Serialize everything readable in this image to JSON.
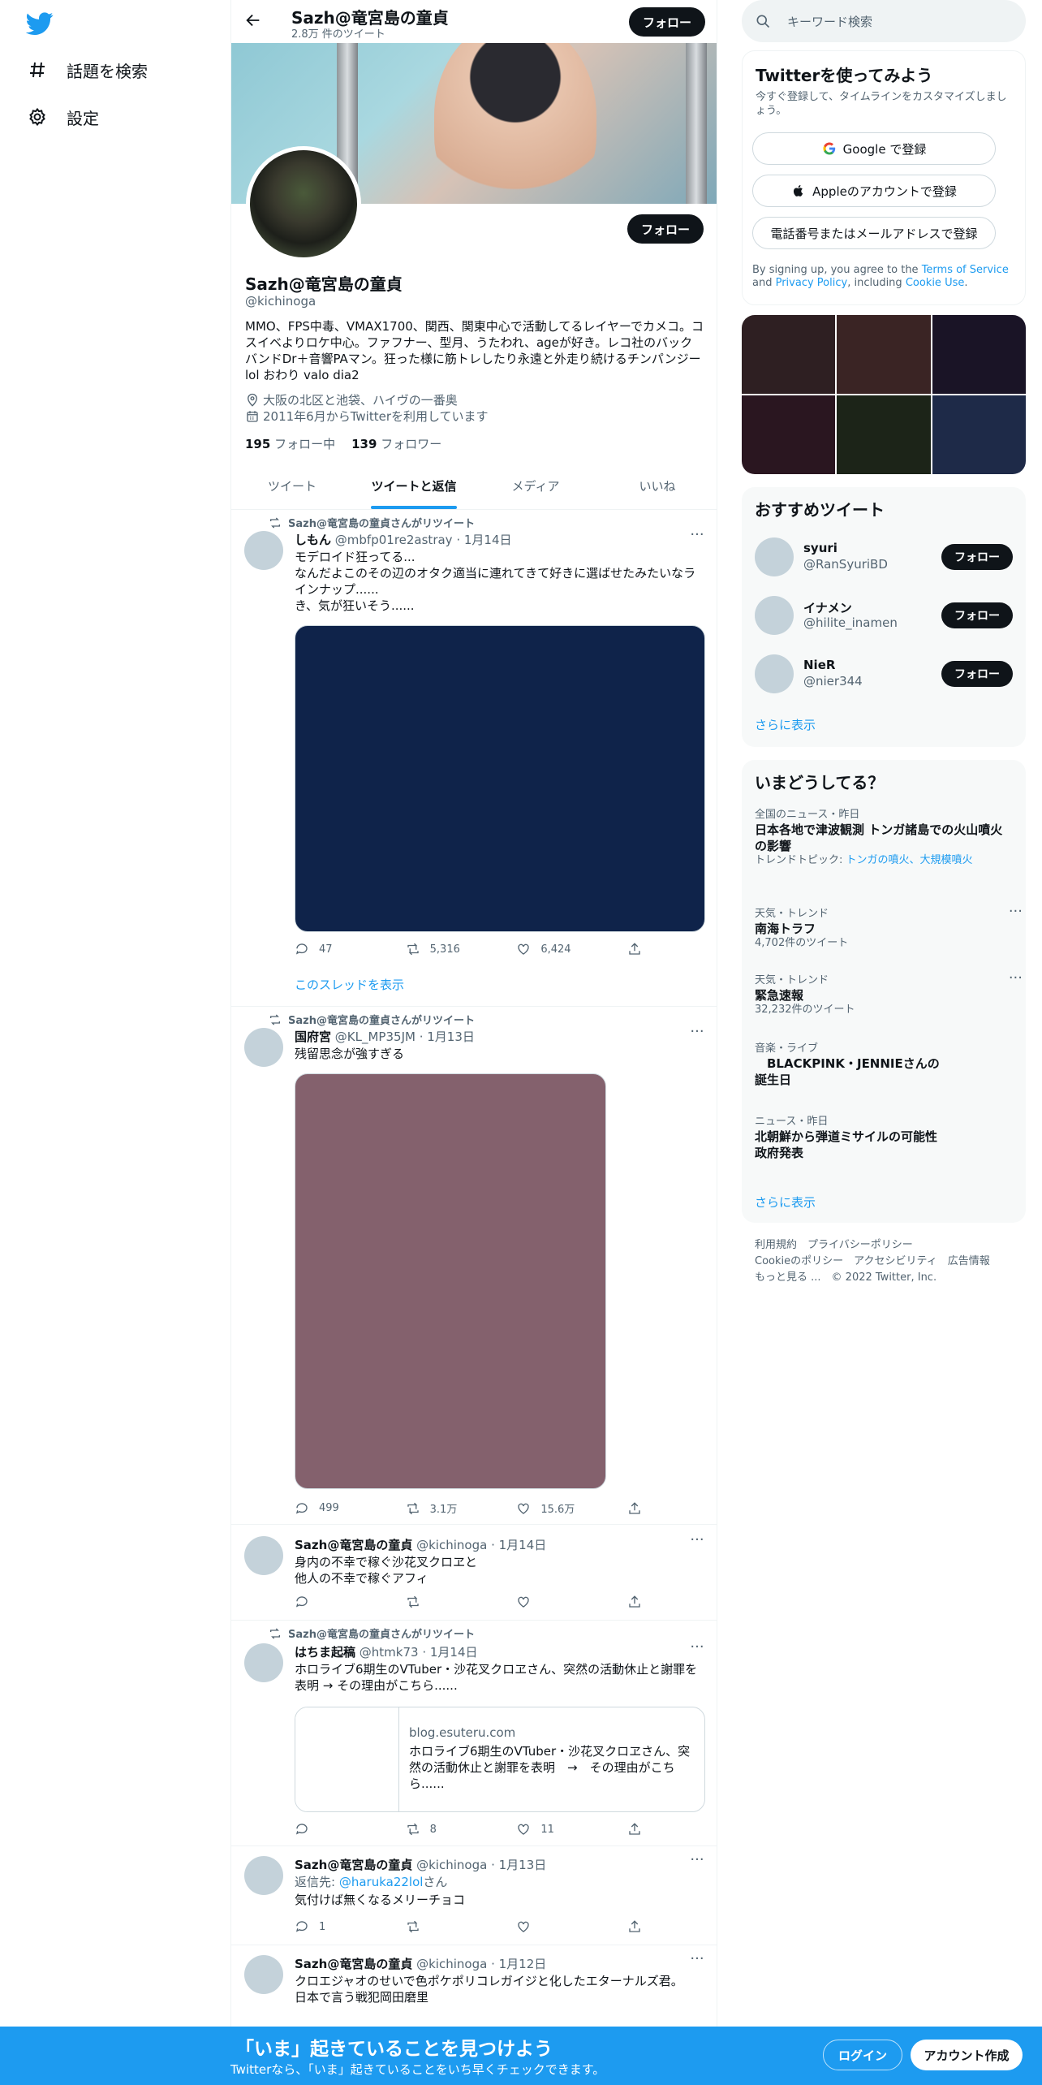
{
  "nav": {
    "explore_label": "話題を検索",
    "settings_label": "設定"
  },
  "header": {
    "name": "Sazh@竜宮島の童貞",
    "tweet_count": "2.8万 件のツイート",
    "follow_label": "フォロー"
  },
  "profile": {
    "name": "Sazh@竜宮島の童貞",
    "handle": "@kichinoga",
    "bio": "MMO、FPS中毒、VMAX1700、関西、関東中心で活動してるレイヤーでカメコ。コスイベよりロケ中心。ファフナー、型月、うたわれ、ageが好き。レコ社のバックバンドDr＋音響PAマン。狂った様に筋トレしたり永遠と外走り続けるチンパンジー\nlol おわり valo dia2",
    "location": "大阪の北区と池袋、ハイヴの一番奥",
    "joined": "2011年6月からTwitterを利用しています",
    "following_count": "195",
    "following_label": "フォロー中",
    "followers_count": "139",
    "followers_label": "フォロワー",
    "follow_label": "フォロー"
  },
  "tabs": [
    "ツイート",
    "ツイートと返信",
    "メディア",
    "いいね"
  ],
  "tweets": [
    {
      "retweeted_by": "Sazh@竜宮島の童貞さんがリツイート",
      "name": "しもん",
      "meta": "@mbfp01re2astray · 1月14日",
      "text": "モデロイド狂ってる...\nなんだよこのその辺のオタク適当に連れてきて好きに選ばせたみたいなラインナップ......\nき、気が狂いそう......",
      "media_color": "#0f234a",
      "replies": "47",
      "retweets": "5,316",
      "likes": "6,424",
      "thread_link": "このスレッドを表示"
    },
    {
      "retweeted_by": "Sazh@竜宮島の童貞さんがリツイート",
      "name": "国府宮",
      "meta": "@KL_MP35JM · 1月13日",
      "text": "残留思念が強すぎる",
      "media_color": "#84616d",
      "replies": "499",
      "retweets": "3.1万",
      "likes": "15.6万"
    },
    {
      "name": "Sazh@竜宮島の童貞",
      "meta": "@kichinoga · 1月14日",
      "text": "身内の不幸で稼ぐ沙花叉クロヱと\n他人の不幸で稼ぐアフィ"
    },
    {
      "retweeted_by": "Sazh@竜宮島の童貞さんがリツイート",
      "name": "はちま起稿",
      "meta": "@htmk73 · 1月14日",
      "text": "ホロライブ6期生のVTuber・沙花叉クロヱさん、突然の活動休止と謝罪を表明 → その理由がこちら......",
      "card_domain": "blog.esuteru.com",
      "card_title": "ホロライブ6期生のVTuber・沙花叉クロヱさん、突然の活動休止と謝罪を表明　→　その理由がこちら......",
      "retweets": "8",
      "likes": "11"
    },
    {
      "name": "Sazh@竜宮島の童貞",
      "meta": "@kichinoga · 1月13日",
      "reply_prefix": "返信先: ",
      "reply_to": "@haruka22lol",
      "reply_suffix": "さん",
      "text": "気付けば無くなるメリーチョコ",
      "replies": "1"
    },
    {
      "name": "Sazh@竜宮島の童貞",
      "meta": "@kichinoga · 1月12日",
      "text": "クロエジャオのせいで色ポケポリコレガイジと化したエターナルズ君。\n日本で言う戦犯岡田磨里"
    }
  ],
  "right": {
    "search_placeholder": "キーワード検索",
    "signup": {
      "title": "Twitterを使ってみよう",
      "subtitle": "今すぐ登録して、タイムラインをカスタマイズしましょう。",
      "google": "Google で登録",
      "apple": "Appleのアカウントで登録",
      "phone": "電話番号またはメールアドレスで登録",
      "legal_pre": "By signing up, you agree to the ",
      "terms": "Terms of Service",
      "and": " and ",
      "privacy": "Privacy Policy",
      "including": ", including ",
      "cookie": "Cookie Use",
      "dot": "."
    },
    "photo_colors": [
      "#2e1f22",
      "#3a2424",
      "#1a1426",
      "#2a1620",
      "#1c2418",
      "#1e2a48"
    ],
    "who": {
      "title": "おすすめツイート",
      "users": [
        {
          "name": "syuri",
          "handle": "@RanSyuriBD",
          "follow": "フォロー"
        },
        {
          "name": "イナメン",
          "handle": "@hilite_inamen",
          "follow": "フォロー"
        },
        {
          "name": "NieR",
          "handle": "@nier344",
          "follow": "フォロー"
        }
      ],
      "more": "さらに表示"
    },
    "trends": {
      "title": "いまどうしてる？",
      "items": [
        {
          "cat": "全国のニュース・昨日",
          "title": "日本各地で津波観測 トンガ諸島での火山噴火の影響",
          "sub_pre": "トレンドトピック: ",
          "sub_link": "トンガの噴火、大規模噴火"
        },
        {
          "cat": "天気・トレンド",
          "title": "南海トラフ",
          "sub": "4,702件のツイート"
        },
        {
          "cat": "天気・トレンド",
          "title": "緊急速報",
          "sub": "32,232件のツイート"
        },
        {
          "cat": "音楽・ライブ",
          "title": "　BLACKPINK・JENNIEさんの誕生日"
        },
        {
          "cat": "ニュース・昨日",
          "title": "北朝鮮から弾道ミサイルの可能性 政府発表"
        }
      ],
      "more": "さらに表示"
    },
    "footer": {
      "l1a": "利用規約",
      "l1b": "プライバシーポリシー",
      "l2a": "Cookieのポリシー",
      "l2b": "アクセシビリティ",
      "l2c": "広告情報",
      "l3a": "もっと見る ...",
      "l3b": "© 2022 Twitter, Inc."
    }
  },
  "bottom": {
    "headline": "「いま」起きていることを見つけよう",
    "subline": "Twitterなら、「いま」起きていることをいち早くチェックできます。",
    "login": "ログイン",
    "signup": "アカウント作成"
  },
  "colors": {
    "accent": "#1d9bf0",
    "dark": "#0f1419",
    "muted": "#536471"
  }
}
